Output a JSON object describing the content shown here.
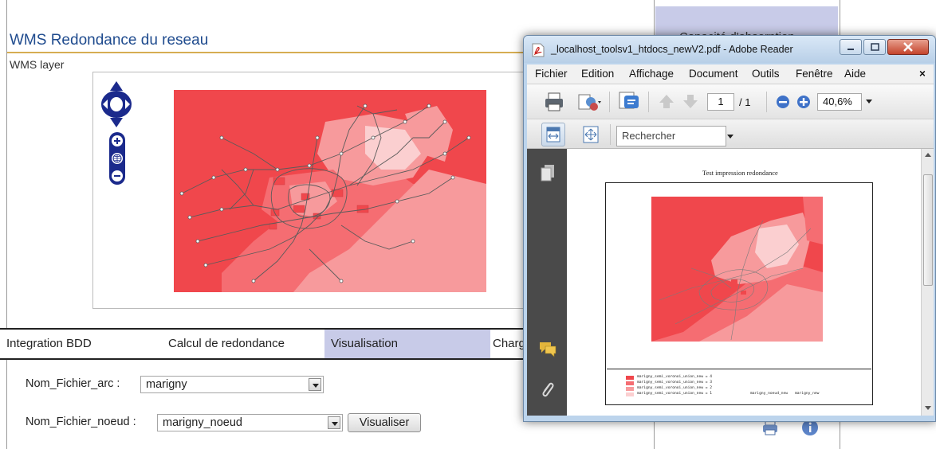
{
  "page": {
    "title": "WMS Redondance du reseau",
    "map_heading": "WMS layer",
    "right_panel_heading": "Capacité d'absorption"
  },
  "tabs": [
    {
      "label": "Integration BDD",
      "active": false
    },
    {
      "label": "Calcul de redondance",
      "active": false
    },
    {
      "label": "Visualisation",
      "active": true
    },
    {
      "label": "Charg",
      "active": false
    }
  ],
  "form": {
    "arc_label": "Nom_Fichier_arc :",
    "arc_value": "marigny",
    "node_label": "Nom_Fichier_noeud :",
    "node_value": "marigny_noeud",
    "visualise_button": "Visualiser"
  },
  "reader": {
    "window_title": "_localhost_toolsv1_htdocs_newV2.pdf - Adobe Reader",
    "menu": [
      "Fichier",
      "Edition",
      "Affichage",
      "Document",
      "Outils",
      "Fenêtre",
      "Aide"
    ],
    "menu_close": "×",
    "page_current": "1",
    "page_total": "/ 1",
    "zoom": "40,6%",
    "search_placeholder": "Rechercher",
    "document": {
      "title": "Test impression redondance",
      "legend": [
        {
          "label": "marigny_semi_voronoi_union_new = 4",
          "color": "#f0474c"
        },
        {
          "label": "marigny_semi_voronoi_union_new = 3",
          "color": "#f56d72"
        },
        {
          "label": "marigny_semi_voronoi_union_new = 2",
          "color": "#f79a9c"
        },
        {
          "label": "marigny_semi_voronoi_union_new = 1",
          "color": "#fbcfd0"
        }
      ],
      "legend_node": "marigny_noeud_new",
      "legend_arc": "marigny_new"
    }
  },
  "colors": {
    "title_blue": "#1f4b8e",
    "tab_active": "#c8cbe8",
    "map_red_4": "#f0474c",
    "map_red_3": "#f56d72",
    "map_red_2": "#f79a9c",
    "map_red_1": "#fbcfd0",
    "pan_zoom_blue": "#1b2a8c"
  },
  "icons": {
    "pan": "pan-arrows-icon",
    "zoom_in": "zoom-in-icon",
    "zoom_world": "world-icon",
    "zoom_out": "zoom-out-icon",
    "print": "printer-icon",
    "info": "info-icon"
  }
}
